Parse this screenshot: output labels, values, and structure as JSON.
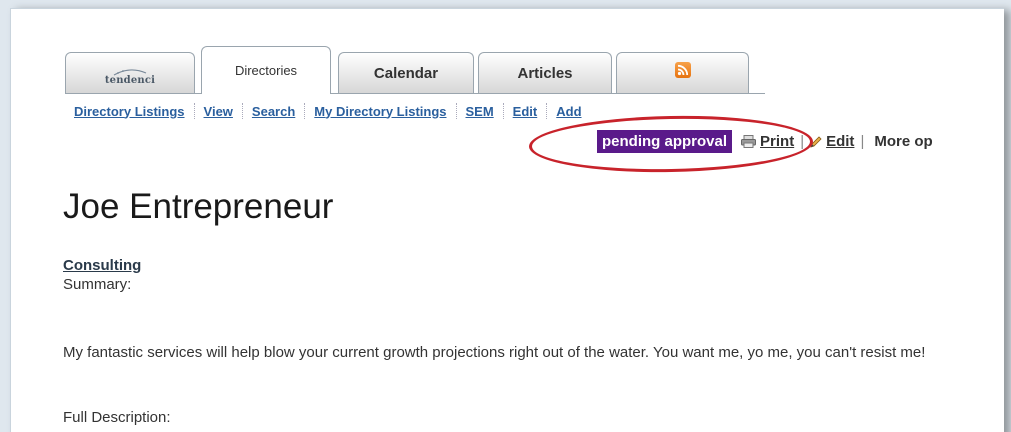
{
  "tabs": [
    {
      "label": "tendenci",
      "kind": "logo"
    },
    {
      "label": "Directories",
      "active": true
    },
    {
      "label": "Calendar"
    },
    {
      "label": "Articles"
    },
    {
      "label": "",
      "icon": "rss-icon"
    }
  ],
  "subnav": {
    "items": [
      "Directory Listings",
      "View",
      "Search",
      "My Directory Listings",
      "SEM",
      "Edit",
      "Add"
    ]
  },
  "actions": {
    "status": "pending approval",
    "print_label": "Print",
    "edit_label": "Edit",
    "separator": "|",
    "more_label": "More op",
    "status_color": "#5a1a8a",
    "highlight_color": "#c8232b"
  },
  "listing": {
    "title": "Joe Entrepreneur",
    "category": "Consulting",
    "summary_label": "Summary:",
    "summary_text": "My fantastic services will help blow your current growth projections right out of the water. You want me, yo me, you can't resist me!",
    "full_description_label": "Full Description:"
  },
  "colors": {
    "link": "#2a5f9e",
    "background": "#dfe7ee"
  }
}
